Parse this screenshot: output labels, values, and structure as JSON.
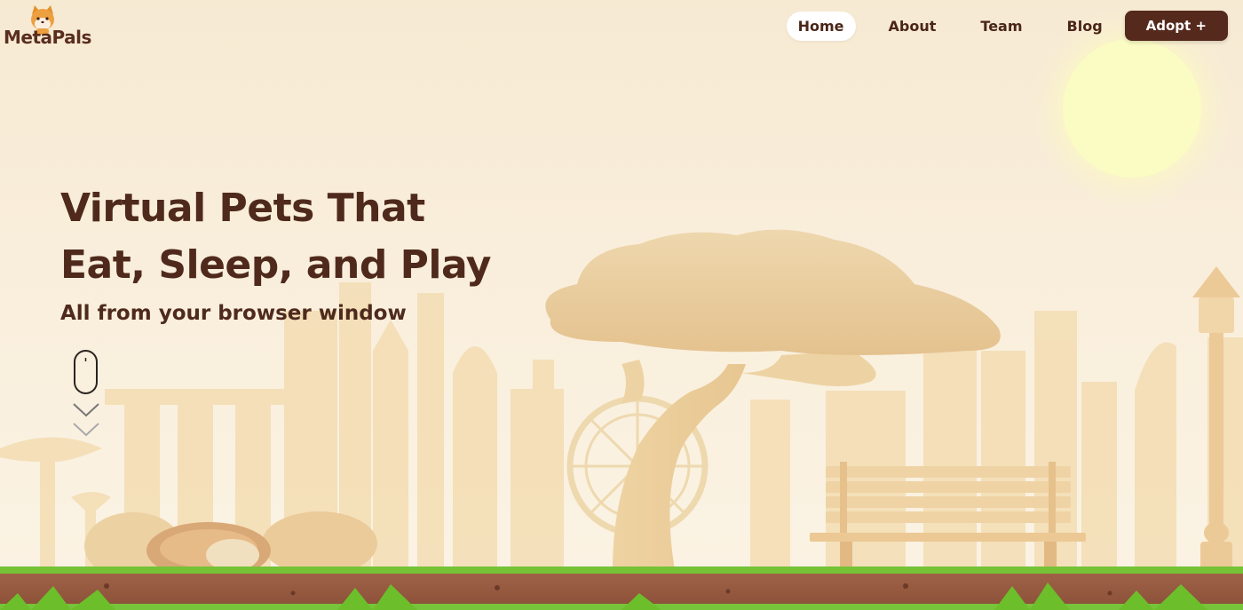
{
  "brand": {
    "name": "MetaPals"
  },
  "nav": {
    "items": [
      {
        "label": "Home",
        "active": true
      },
      {
        "label": "About",
        "active": false
      },
      {
        "label": "Team",
        "active": false
      },
      {
        "label": "Blog",
        "active": false
      }
    ],
    "cta_label": "Adopt +"
  },
  "hero": {
    "title_line1": "Virtual Pets That",
    "title_line2": "Eat, Sleep, and Play",
    "subtitle": "All from your browser window"
  },
  "colors": {
    "primary_text": "#4f2a1c",
    "button_bg": "#55291c",
    "background": "#f7ead3",
    "sun": "#fbf9c2",
    "grass": "#6cbf2a",
    "soil": "#9a5b3d"
  },
  "icons": [
    "mouse-scroll-icon",
    "chevron-down-icon",
    "shiba-mascot-icon"
  ]
}
